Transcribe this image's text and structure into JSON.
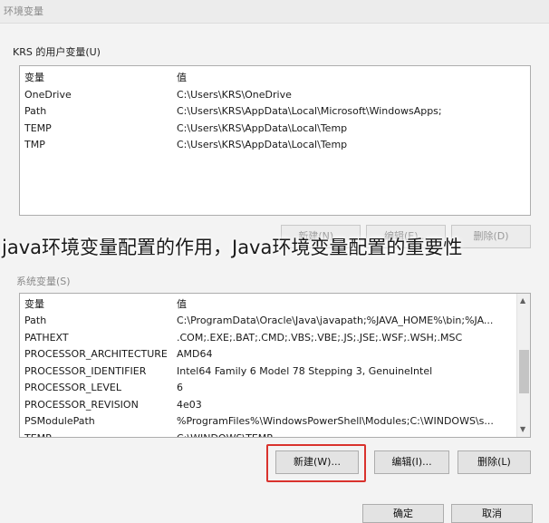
{
  "window": {
    "title": "环境变量"
  },
  "user_vars": {
    "label": "KRS 的用户变量(U)",
    "headers": {
      "name": "变量",
      "value": "值"
    },
    "rows": [
      {
        "name": "OneDrive",
        "value": "C:\\Users\\KRS\\OneDrive"
      },
      {
        "name": "Path",
        "value": "C:\\Users\\KRS\\AppData\\Local\\Microsoft\\WindowsApps;"
      },
      {
        "name": "TEMP",
        "value": "C:\\Users\\KRS\\AppData\\Local\\Temp"
      },
      {
        "name": "TMP",
        "value": "C:\\Users\\KRS\\AppData\\Local\\Temp"
      }
    ],
    "buttons": {
      "new": "新建(N)...",
      "edit": "编辑(E)...",
      "delete": "删除(D)"
    }
  },
  "system_vars": {
    "label": "系统变量(S)",
    "headers": {
      "name": "变量",
      "value": "值"
    },
    "rows": [
      {
        "name": "Path",
        "value": "C:\\ProgramData\\Oracle\\Java\\javapath;%JAVA_HOME%\\bin;%JA..."
      },
      {
        "name": "PATHEXT",
        "value": ".COM;.EXE;.BAT;.CMD;.VBS;.VBE;.JS;.JSE;.WSF;.WSH;.MSC"
      },
      {
        "name": "PROCESSOR_ARCHITECTURE",
        "value": "AMD64"
      },
      {
        "name": "PROCESSOR_IDENTIFIER",
        "value": "Intel64 Family 6 Model 78 Stepping 3, GenuineIntel"
      },
      {
        "name": "PROCESSOR_LEVEL",
        "value": "6"
      },
      {
        "name": "PROCESSOR_REVISION",
        "value": "4e03"
      },
      {
        "name": "PSModulePath",
        "value": "%ProgramFiles%\\WindowsPowerShell\\Modules;C:\\WINDOWS\\s..."
      },
      {
        "name": "TEMP",
        "value": "C:\\WINDOWS\\TEMP"
      }
    ],
    "buttons": {
      "new": "新建(W)...",
      "edit": "编辑(I)...",
      "delete": "删除(L)"
    }
  },
  "footer": {
    "ok": "确定",
    "cancel": "取消"
  },
  "overlay_caption": "java环境变量配置的作用，Java环境变量配置的重要性",
  "colors": {
    "highlight": "#d9322d"
  }
}
